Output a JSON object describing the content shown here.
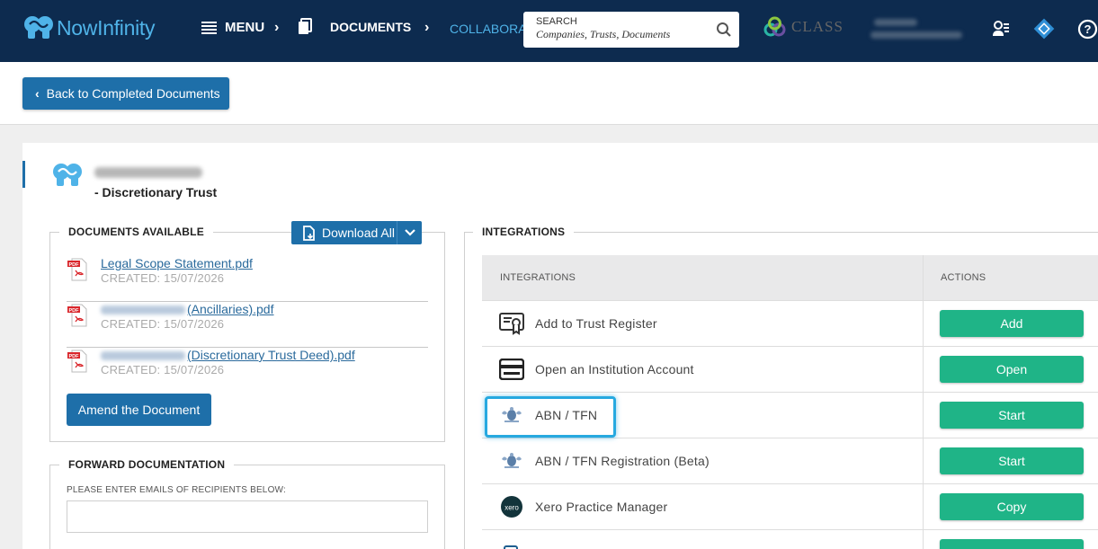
{
  "nav": {
    "brand": "NowInfinity",
    "menu": "MENU",
    "documents": "DOCUMENTS",
    "collaborate": "COLLABORAT",
    "search_label": "SEARCH",
    "search_placeholder": "Companies,  Trusts,  Documents",
    "class_brand": "CLASS"
  },
  "toolbar": {
    "back_label": "Back to Completed Documents"
  },
  "entity": {
    "type": "- Discretionary Trust"
  },
  "documents": {
    "title": "DOCUMENTS AVAILABLE",
    "download_all": "Download All",
    "items": [
      {
        "link": "Legal Scope Statement.pdf",
        "created": "CREATED: 15/07/2026"
      },
      {
        "link": "(Ancillaries).pdf",
        "created": "CREATED: 15/07/2026"
      },
      {
        "link": "(Discretionary Trust Deed).pdf",
        "created": "CREATED: 15/07/2026"
      }
    ],
    "amend": "Amend the Document"
  },
  "forward": {
    "title": "FORWARD DOCUMENTATION",
    "label": "PLEASE ENTER EMAILS OF RECIPIENTS BELOW:"
  },
  "integrations": {
    "title": "INTEGRATIONS",
    "col_integrations": "INTEGRATIONS",
    "col_actions": "ACTIONS",
    "rows": [
      {
        "name": "Add to Trust Register",
        "action": "Add",
        "icon": "certificate-icon"
      },
      {
        "name": "Open an Institution Account",
        "action": "Open",
        "icon": "card-icon"
      },
      {
        "name": "ABN / TFN",
        "action": "Start",
        "icon": "coat-of-arms-icon"
      },
      {
        "name": "ABN / TFN Registration (Beta)",
        "action": "Start",
        "icon": "coat-of-arms-icon"
      },
      {
        "name": "Xero Practice Manager",
        "action": "Copy",
        "icon": "xero-icon"
      },
      {
        "name": "",
        "action": "",
        "icon": "stack-icon"
      }
    ]
  },
  "colors": {
    "nav_bg": "#0d2b4f",
    "primary": "#1e6fa9",
    "action_green": "#1fb487",
    "highlight": "#26a9e0"
  }
}
